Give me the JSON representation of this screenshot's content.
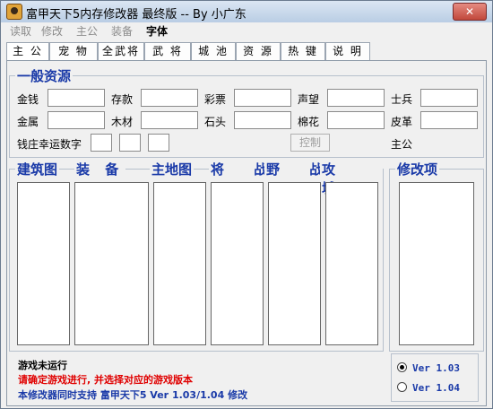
{
  "window": {
    "title": "富甲天下5内存修改器 最终版 -- By 小广东",
    "close_glyph": "✕"
  },
  "menu": [
    "读取",
    "修改",
    "主公",
    "装备",
    "字体"
  ],
  "tabs": [
    "主 公",
    "宠 物",
    "全武将",
    "武 将",
    "城 池",
    "资 源",
    "热 键",
    "说 明"
  ],
  "resources": {
    "title": "一般资源",
    "row1": [
      "金钱",
      "存款",
      "彩票",
      "声望",
      "士兵"
    ],
    "row2": [
      "金属",
      "木材",
      "石头",
      "棉花",
      "皮革"
    ],
    "luck_label": "钱庄幸运数字",
    "control_button": "控制",
    "lord_label": "主公"
  },
  "lists": {
    "headers": [
      "建筑图",
      "装 备",
      "主地图",
      "将 战",
      "野 战",
      "攻 城"
    ],
    "modify_header": "修改项"
  },
  "status": {
    "line1": "游戏未运行",
    "line2": "请确定游戏进行, 并选择对应的游戏版本",
    "line3": "本修改器同时支持 富甲天下5 Ver 1.03/1.04 修改"
  },
  "versions": [
    {
      "label": "Ver 1.03",
      "selected": true
    },
    {
      "label": "Ver 1.04",
      "selected": false
    }
  ],
  "colors": {
    "accent": "#1a3aa8",
    "warning": "#e00000"
  }
}
